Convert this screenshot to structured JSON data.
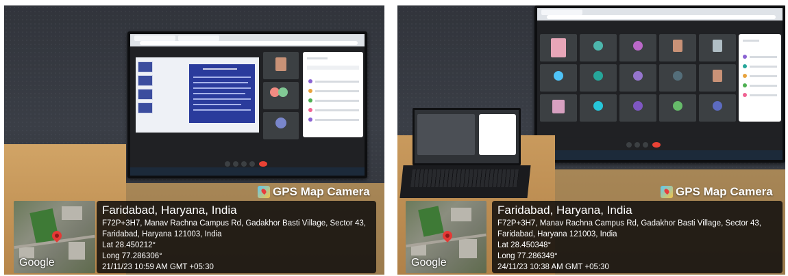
{
  "photos": [
    {
      "gps_brand": "GPS Map Camera",
      "map_credit": "Google",
      "location_title": "Faridabad, Haryana, India",
      "address_line1": "F72P+3H7, Manav Rachna Campus Rd, Gadakhor Basti Village, Sector 43,",
      "address_line2": "Faridabad, Haryana 121003, India",
      "lat": "Lat 28.450212°",
      "long": "Long 77.286306°",
      "timestamp": "21/11/23 10:59 AM GMT +05:30"
    },
    {
      "gps_brand": "GPS Map Camera",
      "map_credit": "Google",
      "location_title": "Faridabad, Haryana, India",
      "address_line1": "F72P+3H7, Manav Rachna Campus Rd, Gadakhor Basti Village, Sector 43,",
      "address_line2": "Faridabad, Haryana 121003, India",
      "lat": "Lat 28.450348°",
      "long": "Long 77.286349°",
      "timestamp": "24/11/23 10:38 AM GMT +05:30"
    }
  ],
  "colors": {
    "meet_red": "#e94235",
    "card_bg": "#08080a",
    "desk_wood": "#c4945a"
  }
}
